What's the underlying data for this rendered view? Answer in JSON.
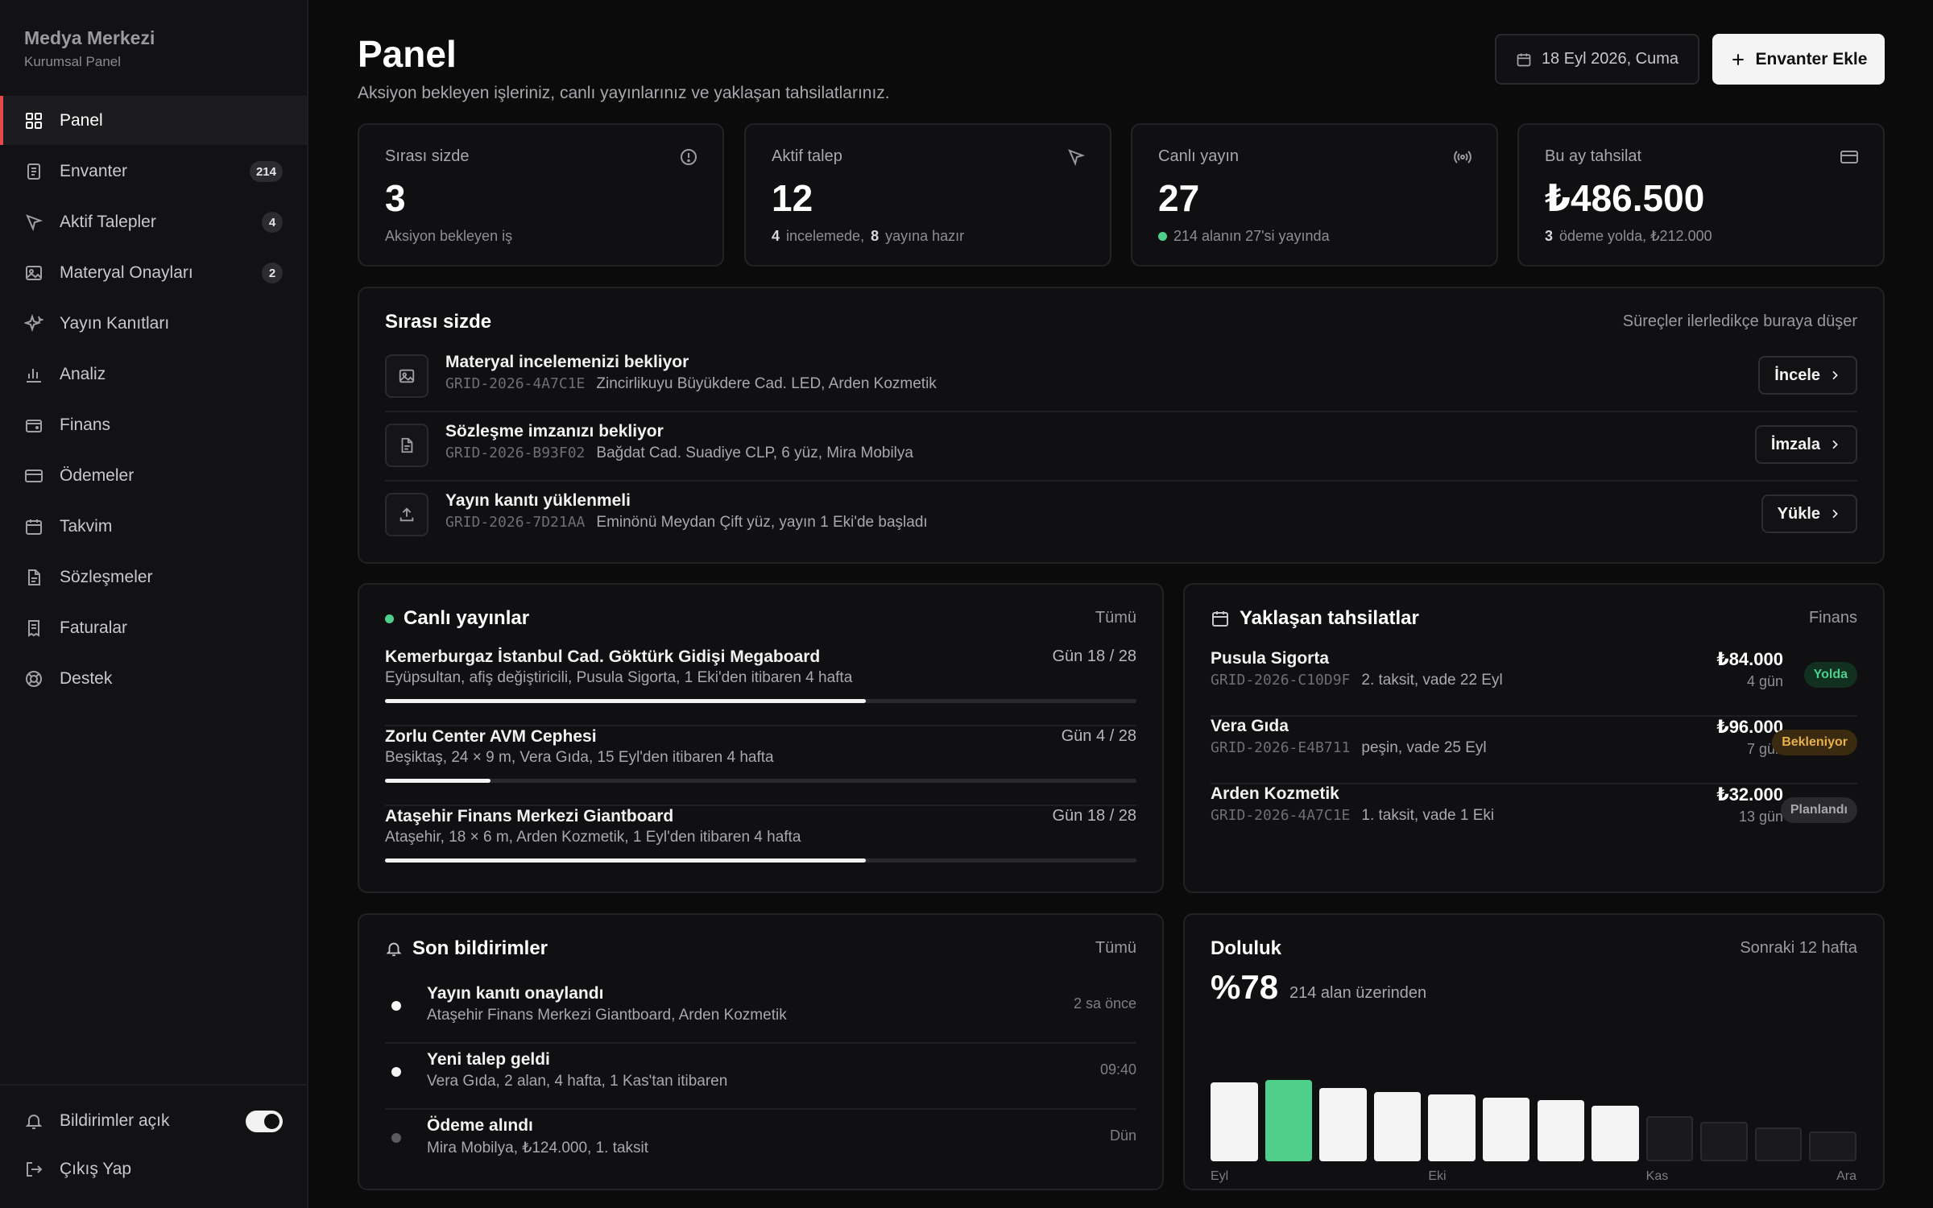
{
  "sidebar": {
    "brand_title": "Medya Merkezi",
    "brand_subtitle": "Kurumsal Panel",
    "items": [
      {
        "label": "Panel",
        "icon": "grid-icon",
        "active": true
      },
      {
        "label": "Envanter",
        "icon": "document-icon",
        "badge": "214"
      },
      {
        "label": "Aktif Talepler",
        "icon": "cursor-icon",
        "badge": "4"
      },
      {
        "label": "Materyal Onayları",
        "icon": "image-icon",
        "badge": "2"
      },
      {
        "label": "Yayın Kanıtları",
        "icon": "sparkle-icon"
      },
      {
        "label": "Analiz",
        "icon": "bar-chart-icon"
      },
      {
        "label": "Finans",
        "icon": "wallet-icon"
      },
      {
        "label": "Ödemeler",
        "icon": "credit-card-icon"
      },
      {
        "label": "Takvim",
        "icon": "calendar-icon"
      },
      {
        "label": "Sözleşmeler",
        "icon": "contract-icon"
      },
      {
        "label": "Faturalar",
        "icon": "receipt-icon"
      },
      {
        "label": "Destek",
        "icon": "lifebuoy-icon"
      }
    ],
    "notifications_label": "Bildirimler açık",
    "notifications_on": true,
    "logout_label": "Çıkış Yap"
  },
  "header": {
    "title": "Panel",
    "subtitle": "Aksiyon bekleyen işleriniz, canlı yayınlarınız ve yaklaşan tahsilatlarınız.",
    "date": "18 Eyl 2026, Cuma",
    "add_button": "Envanter Ekle"
  },
  "stats": [
    {
      "label": "Sırası sizde",
      "value": "3",
      "sub": "Aksiyon bekleyen iş",
      "icon": "alert-circle-icon"
    },
    {
      "label": "Aktif talep",
      "value": "12",
      "sub_n1": "4",
      "sub_t1": "incelemede,",
      "sub_n2": "8",
      "sub_t2": "yayına hazır",
      "icon": "cursor-icon"
    },
    {
      "label": "Canlı yayın",
      "value": "27",
      "sub": "214 alanın 27'si yayında",
      "icon": "broadcast-icon"
    },
    {
      "label": "Bu ay tahsilat",
      "value": "₺486.500",
      "sub_n1": "3",
      "sub_t1": "ödeme yolda, ₺212.000",
      "icon": "credit-card-icon"
    }
  ],
  "queue": {
    "title": "Sırası sizde",
    "hint": "Süreçler ilerledikçe buraya düşer",
    "rows": [
      {
        "title": "Materyal incelemenizi bekliyor",
        "code": "GRID-2026-4A7C1E",
        "detail": "Zincirlikuyu Büyükdere Cad. LED, Arden Kozmetik",
        "action": "İncele",
        "icon": "image-icon"
      },
      {
        "title": "Sözleşme imzanızı bekliyor",
        "code": "GRID-2026-B93F02",
        "detail": "Bağdat Cad. Suadiye CLP, 6 yüz, Mira Mobilya",
        "action": "İmzala",
        "icon": "document-icon"
      },
      {
        "title": "Yayın kanıtı yüklenmeli",
        "code": "GRID-2026-7D21AA",
        "detail": "Eminönü Meydan Çift yüz, yayın 1 Eki'de başladı",
        "action": "Yükle",
        "icon": "upload-icon"
      }
    ]
  },
  "live": {
    "title": "Canlı yayınlar",
    "link": "Tümü",
    "rows": [
      {
        "name": "Kemerburgaz İstanbul Cad. Göktürk Gidişi Megaboard",
        "meta": "Eyüpsultan, afiş değiştiricili, Pusula Sigorta, 1 Eki'den itibaren 4 hafta",
        "day": "Gün 18 / 28",
        "progress": 0.64
      },
      {
        "name": "Zorlu Center AVM Cephesi",
        "meta": "Beşiktaş, 24 × 9 m, Vera Gıda, 15 Eyl'den itibaren 4 hafta",
        "day": "Gün 4 / 28",
        "progress": 0.14
      },
      {
        "name": "Ataşehir Finans Merkezi Giantboard",
        "meta": "Ataşehir, 18 × 6 m, Arden Kozmetik, 1 Eyl'den itibaren 4 hafta",
        "day": "Gün 18 / 28",
        "progress": 0.64
      }
    ]
  },
  "payments": {
    "title": "Yaklaşan tahsilatlar",
    "link": "Finans",
    "rows": [
      {
        "name": "Pusula Sigorta",
        "code": "GRID-2026-C10D9F",
        "detail": "2. taksit, vade 22 Eyl",
        "amount": "₺84.000",
        "days": "4 gün",
        "status": "Yolda",
        "status_color": "green"
      },
      {
        "name": "Vera Gıda",
        "code": "GRID-2026-E4B711",
        "detail": "peşin, vade 25 Eyl",
        "amount": "₺96.000",
        "days": "7 gün",
        "status": "Bekleniyor",
        "status_color": "amber"
      },
      {
        "name": "Arden Kozmetik",
        "code": "GRID-2026-4A7C1E",
        "detail": "1. taksit, vade 1 Eki",
        "amount": "₺32.000",
        "days": "13 gün",
        "status": "Planlandı",
        "status_color": "gray"
      }
    ]
  },
  "notifications": {
    "title": "Son bildirimler",
    "link": "Tümü",
    "rows": [
      {
        "title": "Yayın kanıtı onaylandı",
        "meta": "Ataşehir Finans Merkezi Giantboard, Arden Kozmetik",
        "time": "2 sa önce",
        "unread": true
      },
      {
        "title": "Yeni talep geldi",
        "meta": "Vera Gıda, 2 alan, 4 hafta, 1 Kas'tan itibaren",
        "time": "09:40",
        "unread": true
      },
      {
        "title": "Ödeme alındı",
        "meta": "Mira Mobilya, ₺124.000, 1. taksit",
        "time": "Dün",
        "unread": false
      }
    ]
  },
  "occupancy": {
    "title": "Doluluk",
    "link": "Sonraki 12 hafta",
    "value": "%78",
    "sub": "214 alan üzerinden"
  },
  "chart_data": {
    "type": "bar",
    "title": "Doluluk",
    "x_tick_labels": [
      "Eyl",
      "Eki",
      "Kas",
      "Ara"
    ],
    "values": [
      0.8,
      0.82,
      0.74,
      0.7,
      0.68,
      0.64,
      0.62,
      0.56,
      0.46,
      0.4,
      0.34,
      0.3
    ],
    "highlight_index": 1,
    "future_from_index": 8,
    "colors": {
      "past": "#f4f4f4",
      "current": "#4ed08a",
      "future": "#1a1a1d"
    }
  },
  "colors": {
    "accent": "#e5484d",
    "live_green": "#4ed08a",
    "background": "#0b0b0c"
  }
}
